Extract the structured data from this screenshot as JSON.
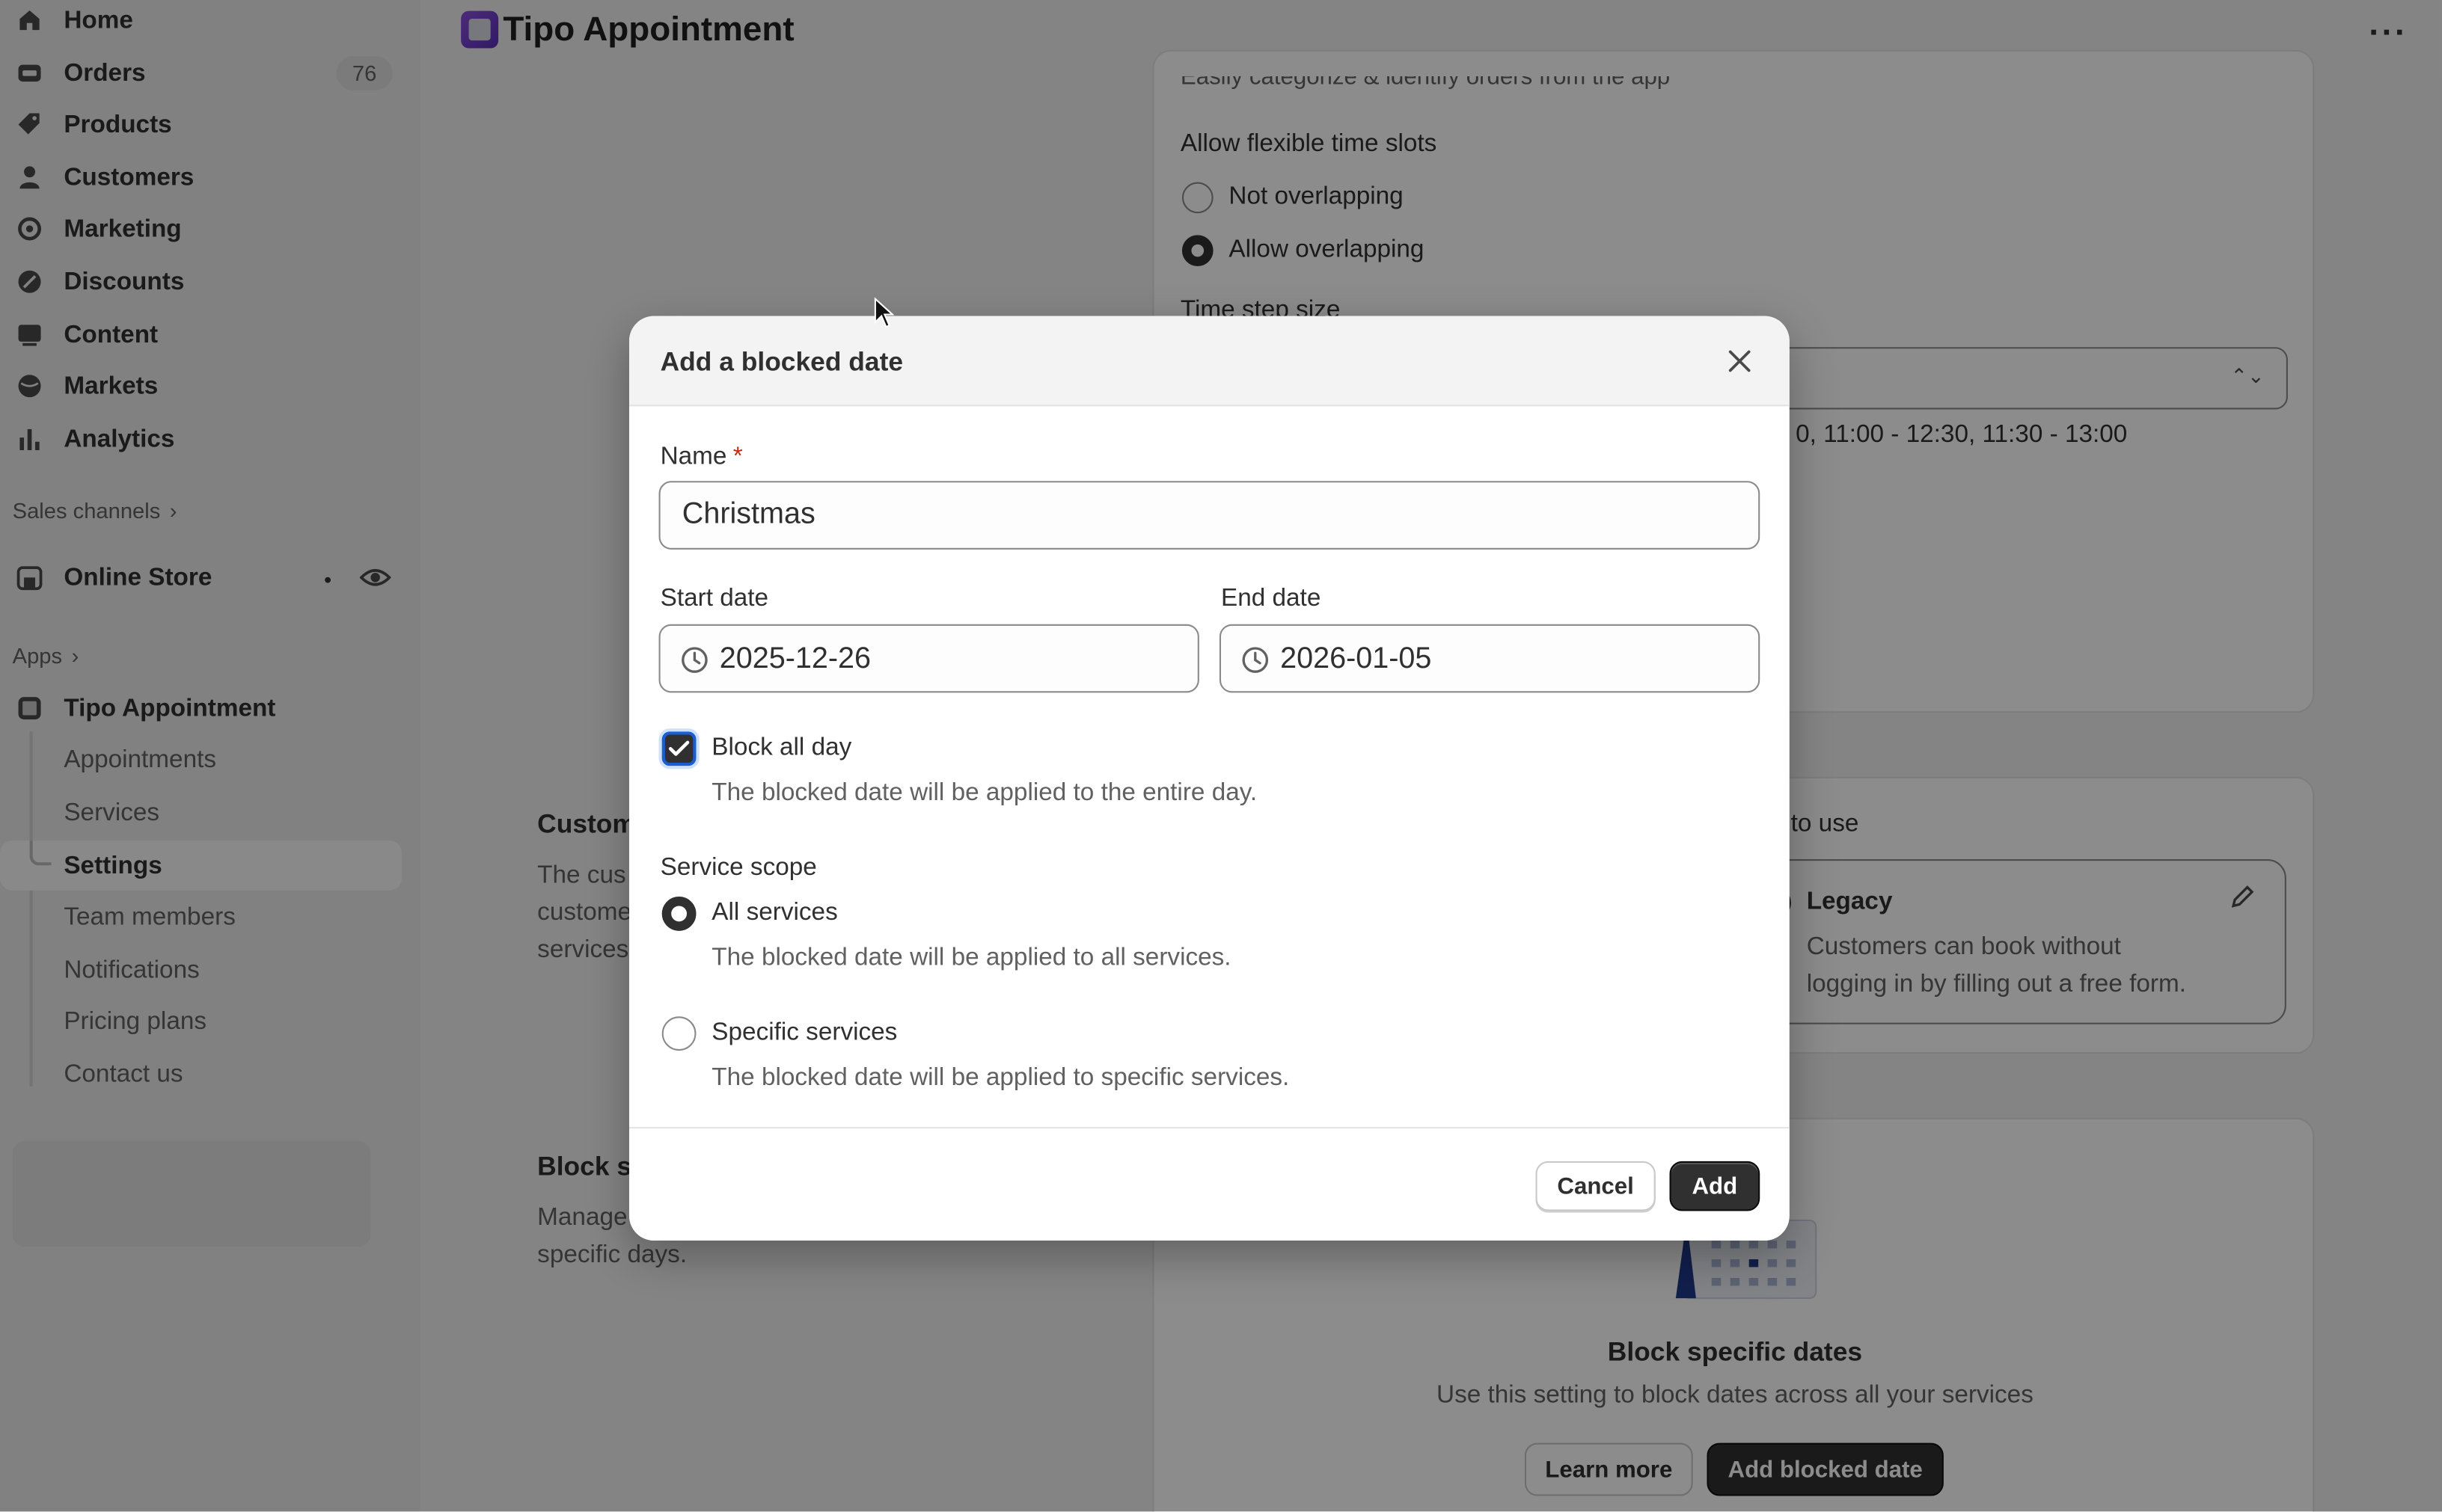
{
  "sidebar": {
    "nav": [
      {
        "label": "Home",
        "icon": "home-icon"
      },
      {
        "label": "Orders",
        "icon": "orders-icon",
        "count": "76"
      },
      {
        "label": "Products",
        "icon": "tag-icon"
      },
      {
        "label": "Customers",
        "icon": "person-icon"
      },
      {
        "label": "Marketing",
        "icon": "target-icon"
      },
      {
        "label": "Discounts",
        "icon": "discount-icon"
      },
      {
        "label": "Content",
        "icon": "content-icon"
      },
      {
        "label": "Markets",
        "icon": "globe-icon"
      },
      {
        "label": "Analytics",
        "icon": "bar-chart-icon"
      }
    ],
    "sales_channels_label": "Sales channels",
    "online_store_label": "Online Store",
    "apps_label": "Apps",
    "app_name": "Tipo Appointment",
    "app_subitems": [
      "Appointments",
      "Services",
      "Settings",
      "Team members",
      "Notifications",
      "Pricing plans",
      "Contact us"
    ]
  },
  "topbar": {
    "title": "Tipo Appointment"
  },
  "background": {
    "cut_off_line": "Easily categorize & identify orders from the app",
    "flexible_slots_label": "Allow flexible time slots",
    "flex_options": [
      "Not overlapping",
      "Allow overlapping"
    ],
    "time_slots_partial": "Time step size",
    "slots_example": "0, 11:00 - 12:30, 11:30 - 13:00",
    "customer_section_title": "Custom",
    "customer_section_desc": [
      "The cus",
      "custome",
      "services"
    ],
    "form_to_use_label": "t to use",
    "legacy_title": "Legacy",
    "legacy_desc": [
      "Customers can book without",
      "logging in by filling out a free form."
    ],
    "block_section_title": "Block s",
    "block_section_desc": [
      "Manage",
      "specific days."
    ],
    "block_card_title": "Block specific dates",
    "block_card_desc": "Use this setting to block dates across all your services",
    "learn_more": "Learn more",
    "add_blocked_date": "Add blocked date"
  },
  "modal": {
    "title": "Add a blocked date",
    "name_label": "Name",
    "name_required_mark": "*",
    "name_value": "Christmas",
    "start_label": "Start date",
    "start_value": "2025-12-26",
    "end_label": "End date",
    "end_value": "2026-01-05",
    "block_all_day_label": "Block all day",
    "block_all_day_checked": true,
    "block_all_day_help": "The blocked date will be applied to the entire day.",
    "scope_label": "Service scope",
    "scope_options": [
      {
        "label": "All services",
        "help": "The blocked date will be applied to all services.",
        "selected": true
      },
      {
        "label": "Specific services",
        "help": "The blocked date will be applied to specific services.",
        "selected": false
      }
    ],
    "cancel_label": "Cancel",
    "add_label": "Add"
  },
  "colors": {
    "primary_button": "#303030",
    "required_mark": "#c5280c",
    "focus_ring": "#1a5ed1"
  }
}
